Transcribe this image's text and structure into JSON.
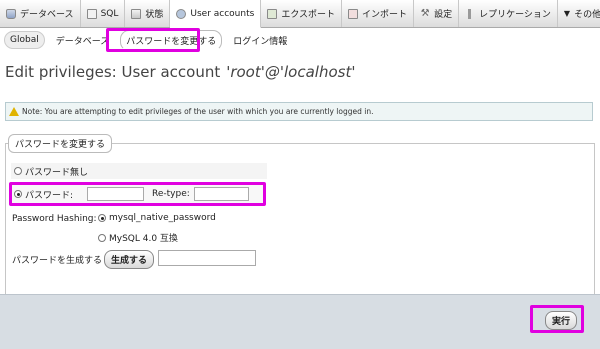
{
  "topmenu": {
    "tabs": [
      {
        "label": "データベース",
        "icon": "database-icon"
      },
      {
        "label": "SQL",
        "icon": "sql-icon"
      },
      {
        "label": "状態",
        "icon": "status-icon"
      },
      {
        "label": "User accounts",
        "icon": "users-icon",
        "active": true
      },
      {
        "label": "エクスポート",
        "icon": "export-icon"
      },
      {
        "label": "インポート",
        "icon": "import-icon"
      },
      {
        "label": "設定",
        "icon": "wrench-icon"
      },
      {
        "label": "レプリケーション",
        "icon": "replication-icon"
      },
      {
        "label": "その他",
        "icon": "chevron-down-icon"
      }
    ]
  },
  "submenu": {
    "global": "Global",
    "database": "データベース",
    "change_password": "パスワードを変更する",
    "login_info": "ログイン情報"
  },
  "page": {
    "title": "Edit privileges: User account",
    "account": "'root'@'localhost'"
  },
  "notice": {
    "text": "Note: You are attempting to edit privileges of the user with which you are currently logged in."
  },
  "form": {
    "legend": "パスワードを変更する",
    "no_password": "パスワード無し",
    "password_label": "パスワード:",
    "password_value": "",
    "retype_label": "Re-type:",
    "retype_value": "",
    "hashing_label": "Password Hashing:",
    "hashing_options": [
      "mysql_native_password",
      "MySQL 4.0 互換"
    ],
    "hashing_selected": "mysql_native_password",
    "generate_label": "パスワードを生成する",
    "generate_button": "生成する",
    "generated_value": ""
  },
  "footer": {
    "go_button": "実行"
  },
  "colors": {
    "highlight": "#e000e0",
    "footer_bg": "#d7dde3",
    "notice_bg": "#eef5f5"
  }
}
